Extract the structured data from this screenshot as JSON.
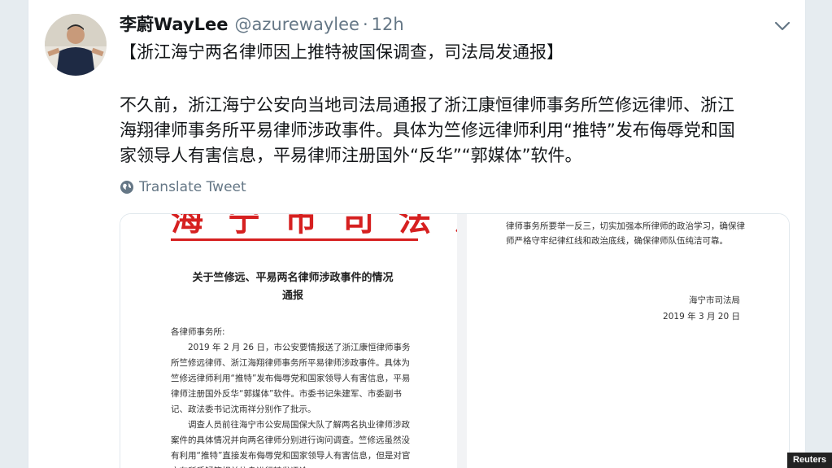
{
  "tweet": {
    "display_name": "李蔚WayLee",
    "handle": "@azurewaylee",
    "separator": "·",
    "time": "12h",
    "title": "【浙江海宁两名律师因上推特被国保调查，司法局发通报】",
    "body_lines": [
      "不久前，浙江海宁公安向当地司法局通报了浙江康恒律师事务所竺修远律师、浙江",
      "海翔律师事务所平易律师涉政事件。具体为竺修远律师利用“推特”发布侮辱党和国",
      "家领导人有害信息，平易律师注册国外“反华”“郭媒体”软件。"
    ],
    "translate_label": "Translate Tweet"
  },
  "document": {
    "header_partial": "海宁市司法局",
    "title_line1": "关于竺修远、平易两名律师涉政事件的情况",
    "title_line2": "通报",
    "salutation": "各律师事务所:",
    "para1": "2019 年 2 月 26 日，市公安要情报送了浙江康恒律师事务所竺修远律师、浙江海翔律师事务所平易律师涉政事件。具体为竺修远律师利用“推特”发布侮辱党和国家领导人有害信息，平易律师注册国外反华“郭媒体”软件。市委书记朱建军、市委副书记、政法委书记沈雨祥分别作了批示。",
    "para2": "调查人员前往海宁市公安局国保大队了解两名执业律师涉政案件的具体情况并向两名律师分别进行询问调查。竺修远虽然没有利用“推特”直接发布侮辱党和国家领导人有害信息，但是对官方有所质疑等相关信息进行转发评论，",
    "right_text": "律师事务所要举一反三，切实加强本所律师的政治学习，确保律师严格守牢纪律红线和政治底线，确保律师队伍纯洁可靠。",
    "issuer": "海宁市司法局",
    "date": "2019 年 3 月 20 日"
  },
  "watermark": "Reuters",
  "colors": {
    "document_red": "#d62020",
    "secondary_text": "#657786",
    "primary_text": "#14171a"
  },
  "icons": {
    "caret": "chevron-down-icon",
    "translate": "globe-icon"
  }
}
